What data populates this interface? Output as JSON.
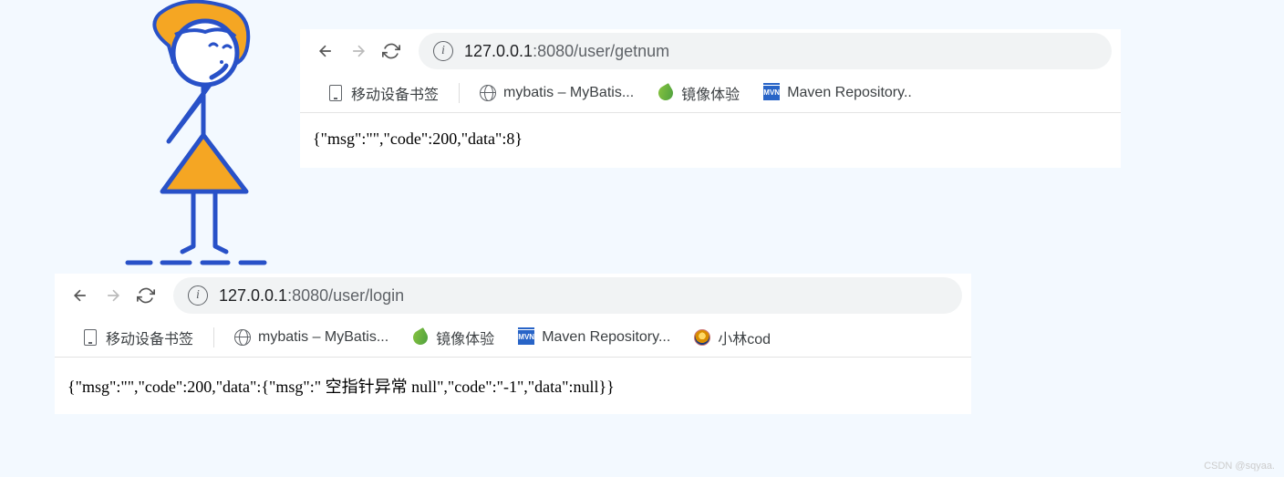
{
  "browser1": {
    "url_host": "127.0.0.1",
    "url_port": ":8080",
    "url_path": "/user/getnum",
    "bookmarks": {
      "mobile": "移动设备书签",
      "mybatis": "mybatis – MyBatis...",
      "mirror": "镜像体验",
      "maven": "Maven Repository..",
      "mvn_label": "MVN"
    },
    "content": "{\"msg\":\"\",\"code\":200,\"data\":8}"
  },
  "browser2": {
    "url_host": "127.0.0.1",
    "url_port": ":8080",
    "url_path": "/user/login",
    "bookmarks": {
      "mobile": "移动设备书签",
      "mybatis": "mybatis – MyBatis...",
      "mirror": "镜像体验",
      "maven": "Maven Repository...",
      "mvn_label": "MVN",
      "xiaolin": "小林cod"
    },
    "content": "{\"msg\":\"\",\"code\":200,\"data\":{\"msg\":\" 空指针异常 null\",\"code\":\"-1\",\"data\":null}}"
  },
  "watermark": "CSDN @sqyaa."
}
